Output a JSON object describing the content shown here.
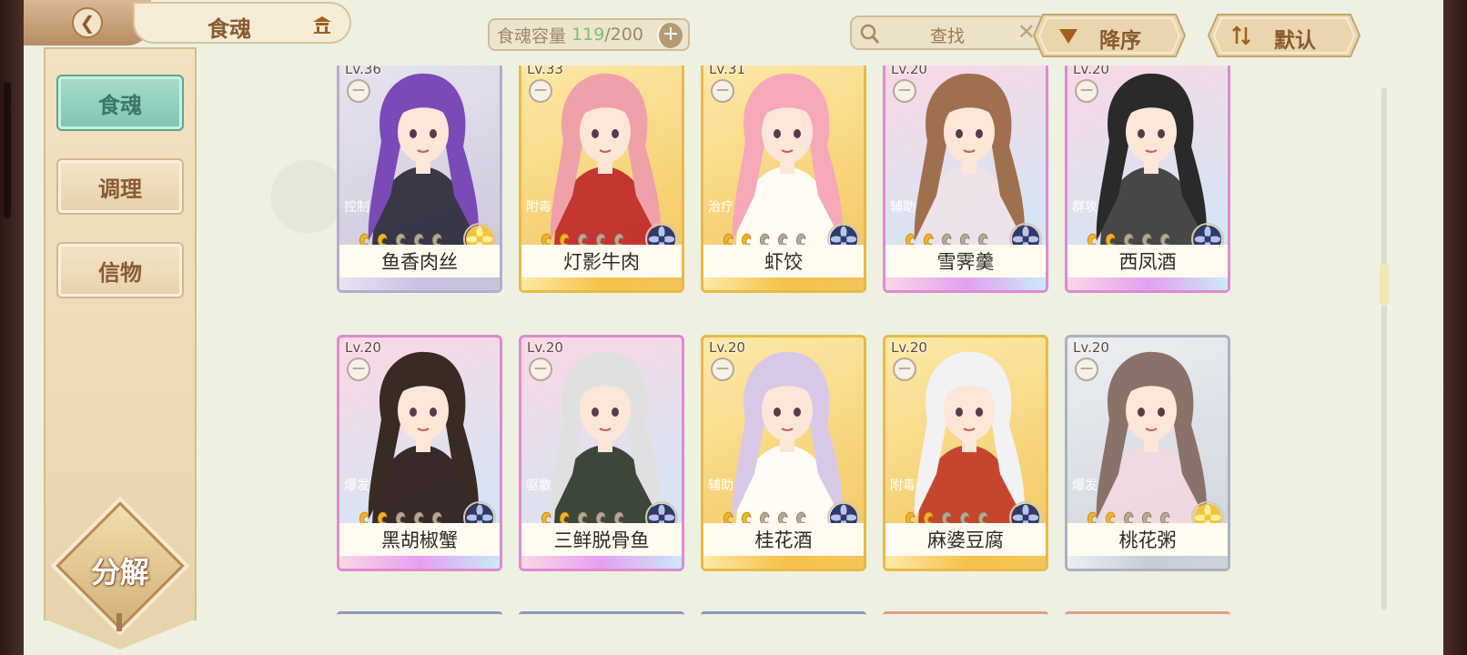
{
  "header": {
    "title": "食魂",
    "capacity_label": "食魂容量",
    "capacity_current": "119",
    "capacity_max": "/200",
    "search_placeholder": "查找",
    "sort_order_label": "降序",
    "sort_mode_label": "默认"
  },
  "sidebar": {
    "tabs": [
      {
        "label": "食魂",
        "active": true
      },
      {
        "label": "调理",
        "active": false
      },
      {
        "label": "信物",
        "active": false
      }
    ],
    "decompose_label": "分解"
  },
  "cards": [
    {
      "level": "Lv.36",
      "role": "控制",
      "name": "鱼香肉丝",
      "stars_filled": 2,
      "stars_total": 5,
      "rarity": "purple-silver",
      "emblem": "gold-flower",
      "hair": "#7a4ab8",
      "outfit": "#2a2a3a"
    },
    {
      "level": "Lv.33",
      "role": "附毒",
      "name": "灯影牛肉",
      "stars_filled": 2,
      "stars_total": 5,
      "rarity": "gold",
      "emblem": "blue-flower",
      "hair": "#f0a0a8",
      "outfit": "#c0282a"
    },
    {
      "level": "Lv.31",
      "role": "治疗",
      "name": "虾饺",
      "stars_filled": 2,
      "stars_total": 5,
      "rarity": "gold",
      "emblem": "blue-flower",
      "hair": "#f6a8b8",
      "outfit": "#ffffff"
    },
    {
      "level": "Lv.20",
      "role": "辅助",
      "name": "雪霁羹",
      "stars_filled": 2,
      "stars_total": 5,
      "rarity": "rainbow",
      "emblem": "blue-flower",
      "hair": "#a0704e",
      "outfit": "#efe2e8"
    },
    {
      "level": "Lv.20",
      "role": "群攻",
      "name": "西凤酒",
      "stars_filled": 2,
      "stars_total": 5,
      "rarity": "rainbow",
      "emblem": "blue-flower",
      "hair": "#2a2a2a",
      "outfit": "#3a3a3a"
    },
    {
      "level": "Lv.20",
      "role": "爆发",
      "name": "黑胡椒蟹",
      "stars_filled": 2,
      "stars_total": 5,
      "rarity": "rainbow",
      "emblem": "blue-flower",
      "hair": "#3a2a24",
      "outfit": "#2a1a18"
    },
    {
      "level": "Lv.20",
      "role": "驱散",
      "name": "三鲜脱骨鱼",
      "stars_filled": 2,
      "stars_total": 5,
      "rarity": "rainbow",
      "emblem": "blue-flower",
      "hair": "#e0e0e0",
      "outfit": "#2e3a2a"
    },
    {
      "level": "Lv.20",
      "role": "辅助",
      "name": "桂花酒",
      "stars_filled": 2,
      "stars_total": 5,
      "rarity": "gold",
      "emblem": "blue-flower",
      "hair": "#d8c8e8",
      "outfit": "#ffffff"
    },
    {
      "level": "Lv.20",
      "role": "附毒",
      "name": "麻婆豆腐",
      "stars_filled": 2,
      "stars_total": 5,
      "rarity": "gold",
      "emblem": "blue-flower",
      "hair": "#f2f2f2",
      "outfit": "#c03a28"
    },
    {
      "level": "Lv.20",
      "role": "爆发",
      "name": "桃花粥",
      "stars_filled": 2,
      "stars_total": 5,
      "rarity": "silver",
      "emblem": "gold-flower",
      "hair": "#8a7268",
      "outfit": "#f2d8e0"
    }
  ],
  "rarity_colors": {
    "gold": {
      "bg1": "#fde9a8",
      "bg2": "#f2c45a",
      "border": "#e9b946",
      "foot": "#f5c24a"
    },
    "rainbow": {
      "bg1": "#fbd7e6",
      "bg2": "#c9e9f8",
      "border": "#e08ad0",
      "foot": "#e4a0f0"
    },
    "purple-silver": {
      "bg1": "#e8e4f0",
      "bg2": "#c8c4d8",
      "border": "#b5abd0",
      "foot": "#c9c0e6"
    },
    "silver": {
      "bg1": "#eceef2",
      "bg2": "#cdd2da",
      "border": "#aab2c0",
      "foot": "#c6ccd8"
    }
  }
}
